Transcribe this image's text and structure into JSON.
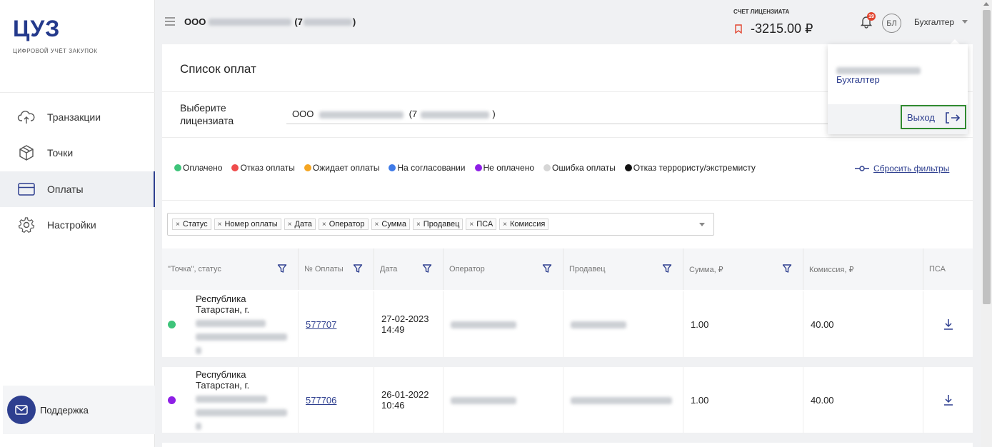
{
  "sidebar": {
    "logo": "ЦУЗ",
    "logo_sub": "ЦИФРОВОЙ УЧЁТ ЗАКУПОК",
    "items": [
      {
        "label": "Транзакции"
      },
      {
        "label": "Точки"
      },
      {
        "label": "Оплаты"
      },
      {
        "label": "Настройки"
      }
    ],
    "support": "Поддержка"
  },
  "header": {
    "org_prefix": "ООО",
    "org_open": "(7",
    "org_close": ")",
    "account_label": "СЧЕТ ЛИЦЕНЗИАТА",
    "account_value": "-3215.00 ₽",
    "notification_count": "19",
    "avatar": "БЛ",
    "role": "Бухгалтер"
  },
  "dropdown": {
    "role": "Бухгалтер",
    "logout": "Выход"
  },
  "main": {
    "title": "Список оплат",
    "licensee_label_1": "Выберите",
    "licensee_label_2": "лицензиата",
    "licensee_prefix": "ООО",
    "licensee_open": "(7",
    "licensee_close": ")",
    "reset_filters": "Сбросить фильтры"
  },
  "legend": [
    {
      "label": "Оплачено",
      "color": "#3ec47a"
    },
    {
      "label": "Отказ оплаты",
      "color": "#ef4c4c"
    },
    {
      "label": "Ожидает оплаты",
      "color": "#f5a623"
    },
    {
      "label": "На согласовании",
      "color": "#3f7be8"
    },
    {
      "label": "Не оплачено",
      "color": "#8e1fe6"
    },
    {
      "label": "Ошибка оплаты",
      "color": "#d6d6d6"
    },
    {
      "label": "Отказ террористу/экстремисту",
      "color": "#111111"
    }
  ],
  "column_chips": [
    "Статус",
    "Номер оплаты",
    "Дата",
    "Оператор",
    "Сумма",
    "Продавец",
    "ПСА",
    "Комиссия"
  ],
  "table": {
    "headers": [
      "\"Точка\", статус",
      "№ Оплаты",
      "Дата",
      "Оператор",
      "Продавец",
      "Сумма, ₽",
      "Комиссия, ₽",
      "ПСА"
    ],
    "rows": [
      {
        "status_color": "#3ec47a",
        "point_1": "Республика",
        "point_2": "Татарстан, г.",
        "number": "577707",
        "date_1": "27-02-2023",
        "date_2": "14:49",
        "sum": "1.00",
        "commission": "40.00"
      },
      {
        "status_color": "#8e1fe6",
        "point_1": "Республика",
        "point_2": "Татарстан, г.",
        "number": "577706",
        "date_1": "26-01-2022",
        "date_2": "10:46",
        "sum": "1.00",
        "commission": "40.00"
      }
    ]
  }
}
